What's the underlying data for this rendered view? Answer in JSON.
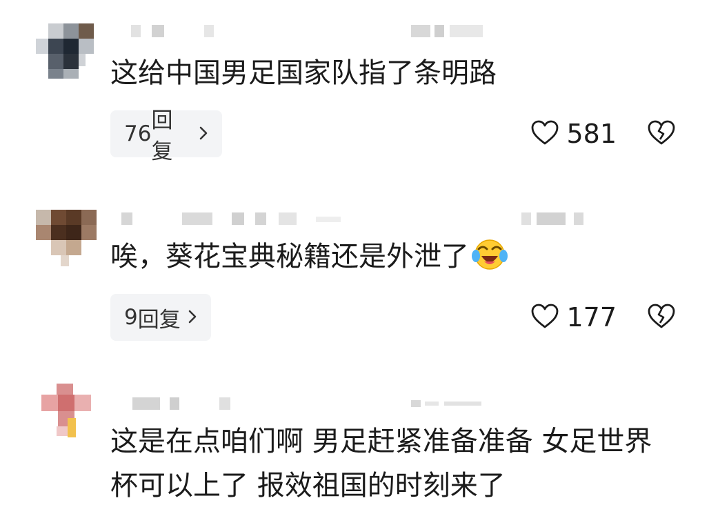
{
  "comments": [
    {
      "text": "这给中国男足国家队指了条明路",
      "replies_count": "76",
      "replies_label": "回复",
      "likes": "581"
    },
    {
      "text": "唉，葵花宝典秘籍还是外泄了",
      "emoji": "laughing-crying-emoji",
      "replies_count": "9",
      "replies_label": "回复",
      "likes": "177"
    },
    {
      "text_line1": "这是在点咱们啊 男足赶紧准备准备 女足世界",
      "text_line2": "杯可以上了 报效祖国的时刻来了"
    }
  ],
  "icons": {
    "like": "heart-outline-icon",
    "dislike": "broken-heart-icon",
    "chevron": "chevron-right-icon"
  },
  "colors": {
    "reply_pill_bg": "#f3f4f6",
    "text": "#1b1b1b",
    "blur_gray": "#dcdcdc"
  }
}
